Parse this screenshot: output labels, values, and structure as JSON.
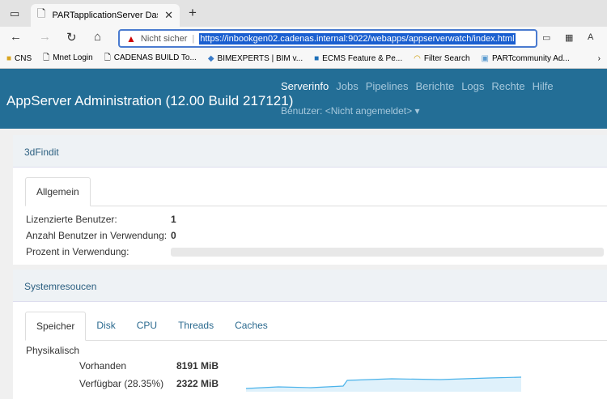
{
  "browser": {
    "tab_title": "PARTapplicationServer Dashboard",
    "security": "Nicht sicher",
    "url": "https://inbookgen02.cadenas.internal:9022/webapps/appserverwatch/index.html",
    "bookmarks": [
      "CNS",
      "Mnet Login",
      "CADENAS BUILD To...",
      "BIMEXPERTS | BIM v...",
      "ECMS Feature & Pe...",
      "Filter Search",
      "PARTcommunity Ad..."
    ]
  },
  "header": {
    "title": "AppServer Administration (12.00 Build 217121)",
    "menu": [
      "Serverinfo",
      "Jobs",
      "Pipelines",
      "Berichte",
      "Logs",
      "Rechte",
      "Hilfe"
    ],
    "user": "Benutzer: <Nicht angemeldet>"
  },
  "panel1": {
    "title": "3dFindit",
    "tab": "Allgemein",
    "rows": [
      {
        "label": "Lizenzierte Benutzer:",
        "value": "1"
      },
      {
        "label": "Anzahl Benutzer in Verwendung:",
        "value": "0"
      }
    ],
    "percent_label": "Prozent in Verwendung:",
    "percent": 0
  },
  "panel2": {
    "title": "Systemresoucen",
    "tabs": [
      "Speicher",
      "Disk",
      "CPU",
      "Threads",
      "Caches"
    ],
    "section": "Physikalisch",
    "rows": [
      {
        "label": "Vorhanden",
        "value": "8191 MiB"
      },
      {
        "label": "Verfügbar (28.35%)",
        "value": "2322 MiB"
      }
    ]
  }
}
